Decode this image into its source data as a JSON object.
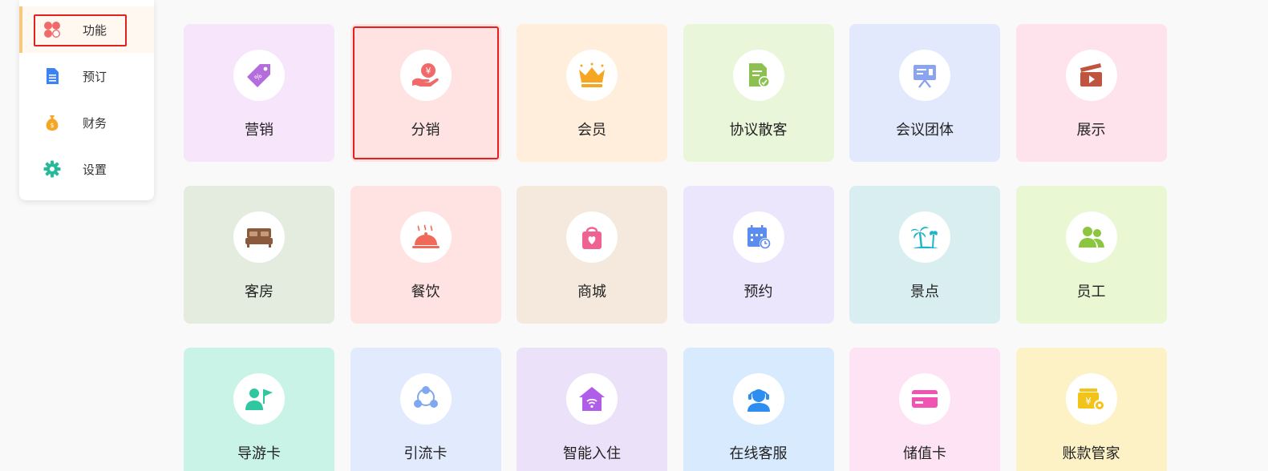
{
  "sidebar": {
    "items": [
      {
        "label": "功能",
        "icon": "function-grid-icon",
        "active": true
      },
      {
        "label": "预订",
        "icon": "document-icon",
        "active": false
      },
      {
        "label": "财务",
        "icon": "money-bag-icon",
        "active": false
      },
      {
        "label": "设置",
        "icon": "gear-icon",
        "active": false
      }
    ]
  },
  "tiles": [
    {
      "label": "营销",
      "icon": "coupon-tag-icon",
      "bg": "#f7e6fb",
      "color": "#b46ddc"
    },
    {
      "label": "分销",
      "icon": "hand-yuan-icon",
      "bg": "#ffe3e3",
      "color": "#f06a6a",
      "selected": true
    },
    {
      "label": "会员",
      "icon": "crown-icon",
      "bg": "#ffeedb",
      "color": "#f5a623"
    },
    {
      "label": "协议散客",
      "icon": "contract-icon",
      "bg": "#e9f6d9",
      "color": "#8cc152"
    },
    {
      "label": "会议团体",
      "icon": "presentation-icon",
      "bg": "#e3e9fd",
      "color": "#8aa4f0"
    },
    {
      "label": "展示",
      "icon": "clapperboard-icon",
      "bg": "#fee3ec",
      "color": "#c0553f"
    },
    {
      "label": "客房",
      "icon": "bed-icon",
      "bg": "#e4ecdf",
      "color": "#8b5a3c"
    },
    {
      "label": "餐饮",
      "icon": "food-cloche-icon",
      "bg": "#ffe3e3",
      "color": "#f06a5a"
    },
    {
      "label": "商城",
      "icon": "shopping-bag-icon",
      "bg": "#f4e9dc",
      "color": "#f06292"
    },
    {
      "label": "预约",
      "icon": "calendar-clock-icon",
      "bg": "#ece6fd",
      "color": "#5b8def"
    },
    {
      "label": "景点",
      "icon": "palm-tree-icon",
      "bg": "#d9eef0",
      "color": "#1fb5c8"
    },
    {
      "label": "员工",
      "icon": "staff-icon",
      "bg": "#eaf7d3",
      "color": "#8cc63f"
    },
    {
      "label": "导游卡",
      "icon": "guide-flag-icon",
      "bg": "#c9f3e6",
      "color": "#2fc7a0"
    },
    {
      "label": "引流卡",
      "icon": "share-network-icon",
      "bg": "#e2ebfe",
      "color": "#7fa8f0"
    },
    {
      "label": "智能入住",
      "icon": "smart-home-icon",
      "bg": "#ebe1f8",
      "color": "#b05ee8"
    },
    {
      "label": "在线客服",
      "icon": "customer-service-icon",
      "bg": "#d8eafd",
      "color": "#2e8ef0"
    },
    {
      "label": "储值卡",
      "icon": "card-icon",
      "bg": "#fde3f3",
      "color": "#f053b4"
    },
    {
      "label": "账款管家",
      "icon": "yuan-gear-icon",
      "bg": "#fdf1c6",
      "color": "#f2c318"
    }
  ]
}
